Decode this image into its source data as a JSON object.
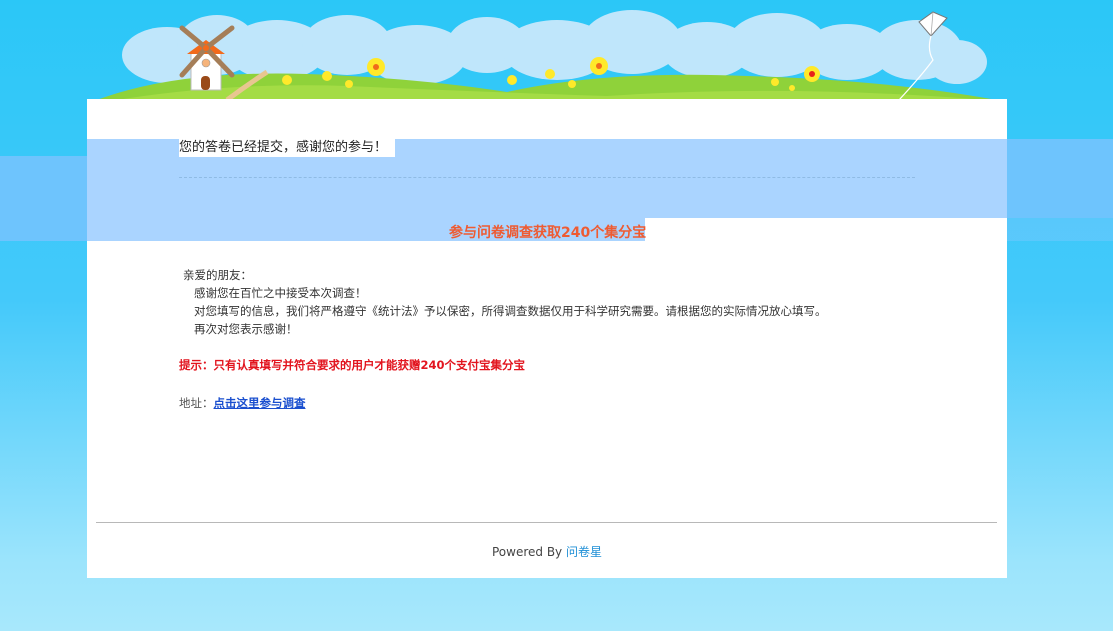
{
  "confirmation": {
    "title": "您的答卷已经提交，感谢您的参与！"
  },
  "promo": {
    "text": "参与问卷调查获取240个集分宝",
    "color": "#ee5b32"
  },
  "letter": {
    "greeting": "亲爱的朋友：",
    "lines": [
      "感谢您在百忙之中接受本次调查！",
      "对您填写的信息，我们将严格遵守《统计法》予以保密，所得调查数据仅用于科学研究需要。请根据您的实际情况放心填写。",
      "再次对您表示感谢！"
    ]
  },
  "tip": {
    "text": "提示：只有认真填写并符合要求的用户才能获赠240个支付宝集分宝",
    "color": "#e2141e"
  },
  "address": {
    "label": "地址：",
    "link_text": "点击这里参与调查"
  },
  "footer": {
    "powered_by": "Powered By",
    "brand": "问卷星"
  },
  "banner": {
    "icons": [
      "windmill-icon",
      "kite-icon",
      "flower-icon",
      "cloud-icon"
    ]
  }
}
